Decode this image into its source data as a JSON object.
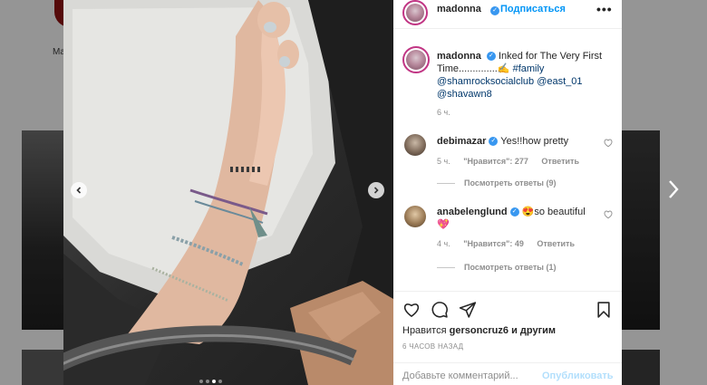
{
  "background": {
    "profile_label": "Ma"
  },
  "photo": {
    "dots_total": 4,
    "dots_active_index": 2
  },
  "post": {
    "author": {
      "username": "madonna",
      "verified": true,
      "follow_label": "Подписаться"
    },
    "caption": {
      "username": "madonna",
      "text": "Inked for The Very First Time..............✍ ",
      "hashtag": "#family",
      "mentions_line1": "@shamrocksocialclub @east_01",
      "mentions_line2": "@shavawn8",
      "time": "6 ч."
    },
    "comments": [
      {
        "username": "debimazar",
        "verified": true,
        "text": "Yes!!how pretty",
        "time": "5 ч.",
        "likes": "\"Нравится\": 277",
        "reply_label": "Ответить",
        "view_replies": "Посмотреть ответы (9)"
      },
      {
        "username": "anabelenglund",
        "verified": true,
        "text": "😍so beautiful 💖",
        "time": "4 ч.",
        "likes": "\"Нравится\": 49",
        "reply_label": "Ответить",
        "view_replies": "Посмотреть ответы (1)"
      }
    ],
    "likes_prefix": "Нравится",
    "likes_user": "gersoncruz6",
    "likes_suffix": "и другим",
    "time_ago": "6 ЧАСОВ НАЗАД",
    "comment_placeholder": "Добавьте комментарий...",
    "publish_label": "Опубликовать"
  },
  "colors": {
    "accent": "#0095f6",
    "verified": "#3897f0",
    "publish_disabled": "#b2dffc",
    "story_ring": "#c13584"
  }
}
